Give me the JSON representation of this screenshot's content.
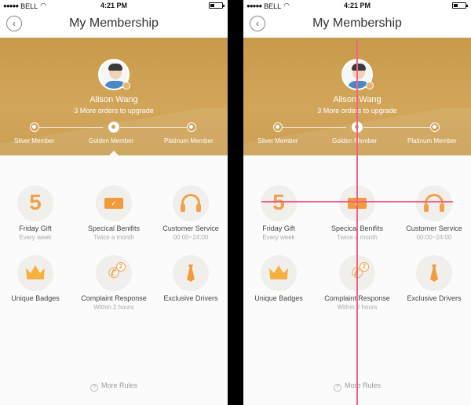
{
  "status": {
    "carrier": "BELL",
    "time": "4:21 PM",
    "signal_dots": "●●●●●"
  },
  "nav": {
    "title": "My Membership",
    "back_icon": "chevron-left-icon"
  },
  "user": {
    "name": "Alison Wang",
    "subtitle": "3 More orders to upgrade"
  },
  "levels": [
    "Silver Member",
    "Golden Member",
    "Platinum Member"
  ],
  "current_level": "Golden Member",
  "benefits": [
    {
      "title": "Friday Gift",
      "sub": "Every week",
      "icon": "five-icon"
    },
    {
      "title": "Specical Benifits",
      "sub": "Twice a month",
      "icon": "ticket-icon"
    },
    {
      "title": "Customer Service",
      "sub": "00:00~24:00",
      "icon": "headset-icon"
    },
    {
      "title": "Unique Badges",
      "sub": "",
      "icon": "crown-icon"
    },
    {
      "title": "Complaint Response",
      "sub": "Within 2 hours",
      "icon": "phone-icon"
    },
    {
      "title": "Exclusive Drivers",
      "sub": "",
      "icon": "tie-icon"
    }
  ],
  "icon_text": {
    "five": "5",
    "ticket_check": "✓",
    "phone": "✆",
    "phone_num": "2"
  },
  "footer": {
    "more_rules": "More Rules",
    "help_glyph": "?"
  },
  "colors": {
    "gold": "#cfa257",
    "accent": "#f0a24a",
    "guide": "#f06088"
  }
}
